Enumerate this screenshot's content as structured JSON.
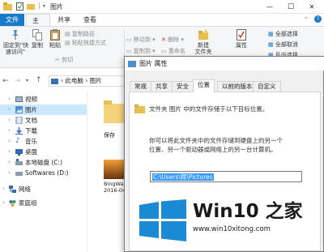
{
  "window": {
    "title": "图片",
    "qat_separator": "|",
    "controls": {
      "minimize": "—",
      "maximize": "☐",
      "close": "✕"
    }
  },
  "ribbon_tabs": [
    "文件",
    "主页",
    "共享",
    "查看"
  ],
  "ribbon": {
    "pin_label": "固定到\"快\n速访问\"",
    "copy_label": "复制",
    "paste_label": "粘贴",
    "copy_path_label": "复制路径",
    "paste_shortcut_label": "粘贴快捷方式",
    "cut_label": "剪切",
    "move_to_label": "移动到",
    "copy_to_label": "复制到",
    "delete_label": "删除",
    "rename_label": "重命名",
    "new_folder_label": "新建\n文件夹",
    "properties_label": "属性",
    "select_all_label": "全部选择",
    "select_none_label": "全部取消",
    "invert_selection_label": "反向选择"
  },
  "address": {
    "segments": [
      "此电脑",
      "图片"
    ],
    "separator": "›"
  },
  "nav_items": [
    {
      "label": "视频",
      "icon": "video-icon",
      "selected": false
    },
    {
      "label": "图片",
      "icon": "pictures-icon",
      "selected": true
    },
    {
      "label": "文档",
      "icon": "documents-icon",
      "selected": false
    },
    {
      "label": "下载",
      "icon": "download-icon",
      "selected": false
    },
    {
      "label": "音乐",
      "icon": "music-icon",
      "selected": false
    },
    {
      "label": "桌面",
      "icon": "desktop-icon",
      "selected": false
    },
    {
      "label": "本地磁盘 (C:)",
      "icon": "drive-icon",
      "selected": false
    },
    {
      "label": "Softwares (D:)",
      "icon": "drive-icon",
      "selected": false
    },
    {
      "label": "网络",
      "icon": "network-icon",
      "selected": false
    },
    {
      "label": "家庭组",
      "icon": "homegroup-icon",
      "selected": false
    }
  ],
  "content_items": [
    {
      "label": "保存",
      "type": "folder"
    },
    {
      "label": "BingWa\n2016-04",
      "type": "image"
    }
  ],
  "dialog": {
    "title": "图片 属性",
    "tabs": [
      "常规",
      "共享",
      "安全",
      "位置",
      "以前的版本",
      "自定义"
    ],
    "active_tab": "位置",
    "folder_caption": "文件夹 图片 中的文件存储于以下目标位置。",
    "description": "你可以将此文件夹中的文件存储到硬盘上的另一个\n位置、另一个驱动器或网络上的另一台计算机。",
    "path_value": "C:\\Users\\辉\\Pictures"
  },
  "watermark": {
    "title": "Win10 之家",
    "url": "www.win10xitong.com"
  },
  "colors": {
    "accent": "#1979ca",
    "selection": "#cce8ff",
    "text_selection": "#3399ff",
    "win_logo": "#1a8ad4"
  }
}
